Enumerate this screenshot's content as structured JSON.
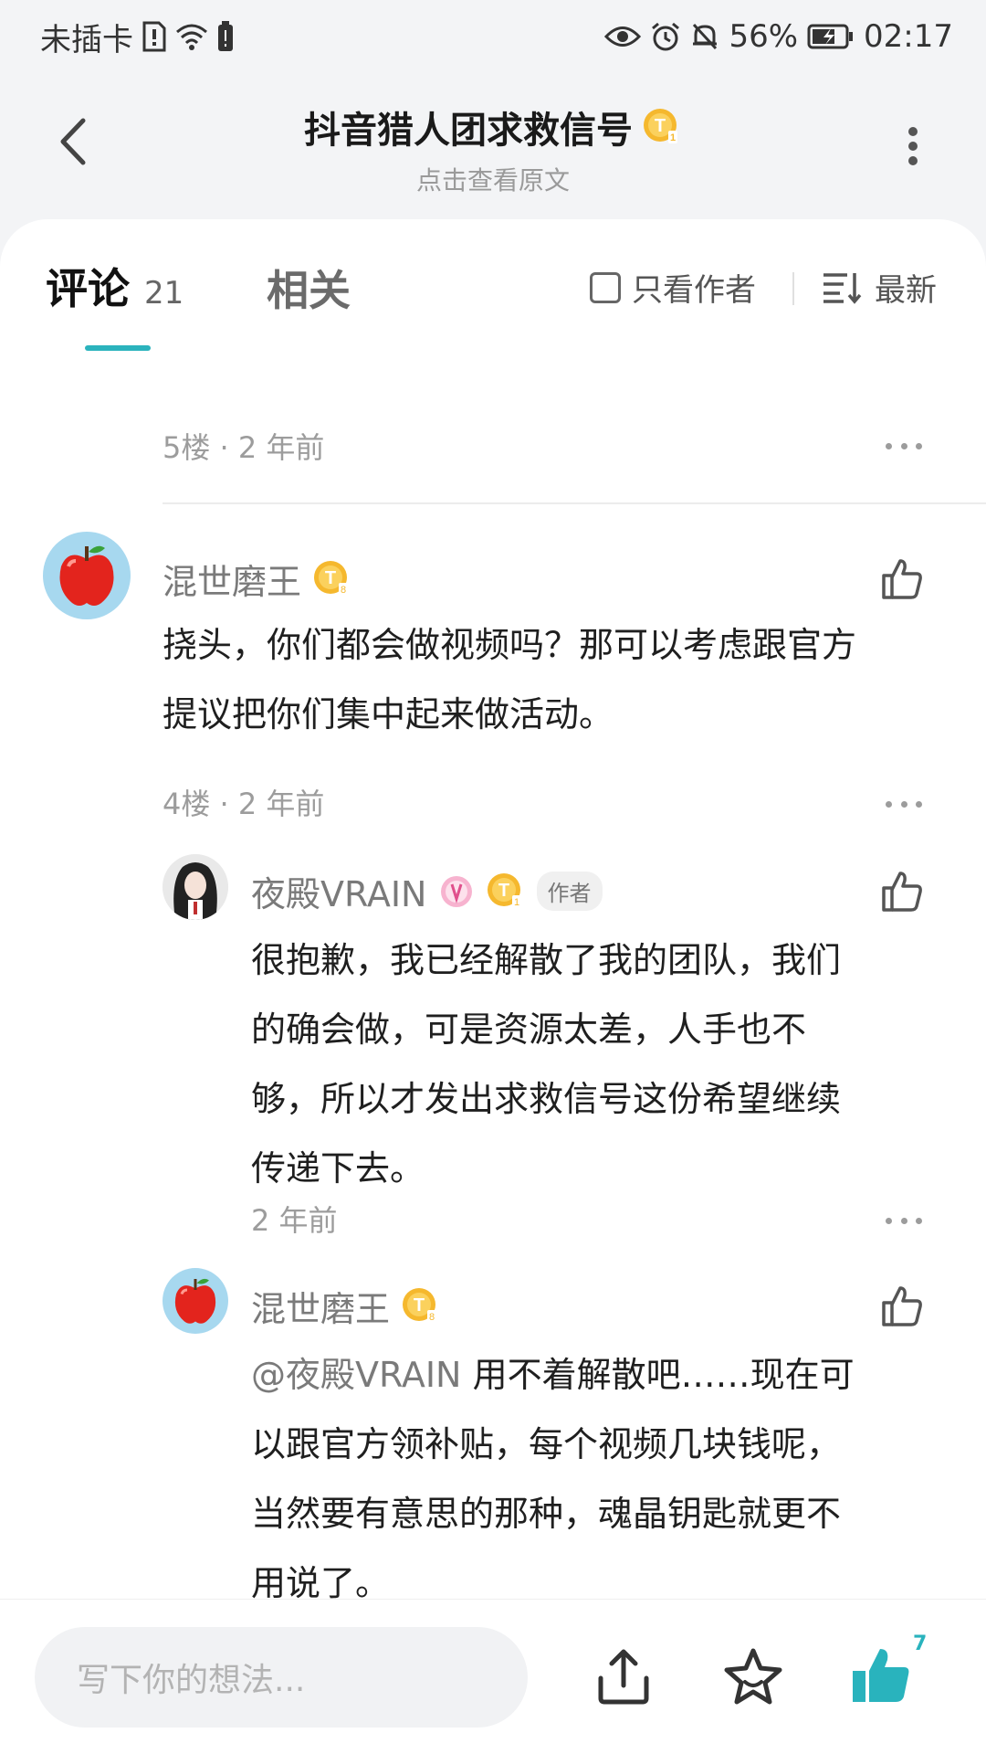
{
  "status_bar": {
    "carrier": "未插卡",
    "battery_percent": "56%",
    "time": "02:17"
  },
  "header": {
    "title": "抖音猎人团求救信号",
    "subtitle": "点击查看原文"
  },
  "tabs": {
    "comments_label": "评论",
    "comments_count": "21",
    "related_label": "相关",
    "author_only_label": "只看作者",
    "sort_label": "最新"
  },
  "comments": {
    "floor5": {
      "floor": "5楼",
      "time": "2 年前"
    },
    "floor4_meta": {
      "floor": "4楼",
      "time": "2 年前"
    },
    "main": {
      "username": "混世磨王",
      "text_line1": "挠头，你们都会做视频吗？那可以考虑跟官方",
      "text_line2": "提议把你们集中起来做活动。"
    },
    "reply1": {
      "username": "夜殿VRAIN",
      "author_tag": "作者",
      "text_line1": "很抱歉，我已经解散了我的团队，我们",
      "text_line2": "的确会做，可是资源太差，人手也不",
      "text_line3": "够，所以才发出求救信号这份希望继续",
      "text_line4": "传递下去。",
      "time": "2 年前"
    },
    "reply2": {
      "username": "混世磨王",
      "mention": "@夜殿VRAIN",
      "text_line1": "用不着解散吧……现在可",
      "text_line2": "以跟官方领补贴，每个视频几块钱呢，",
      "text_line3": "当然要有意思的那种，魂晶钥匙就更不",
      "text_line4": "用说了。"
    }
  },
  "bottom_bar": {
    "input_placeholder": "写下你的想法...",
    "like_count": "7"
  },
  "colors": {
    "accent": "#2bb3bd",
    "badge_gold": "#f5b82e"
  }
}
